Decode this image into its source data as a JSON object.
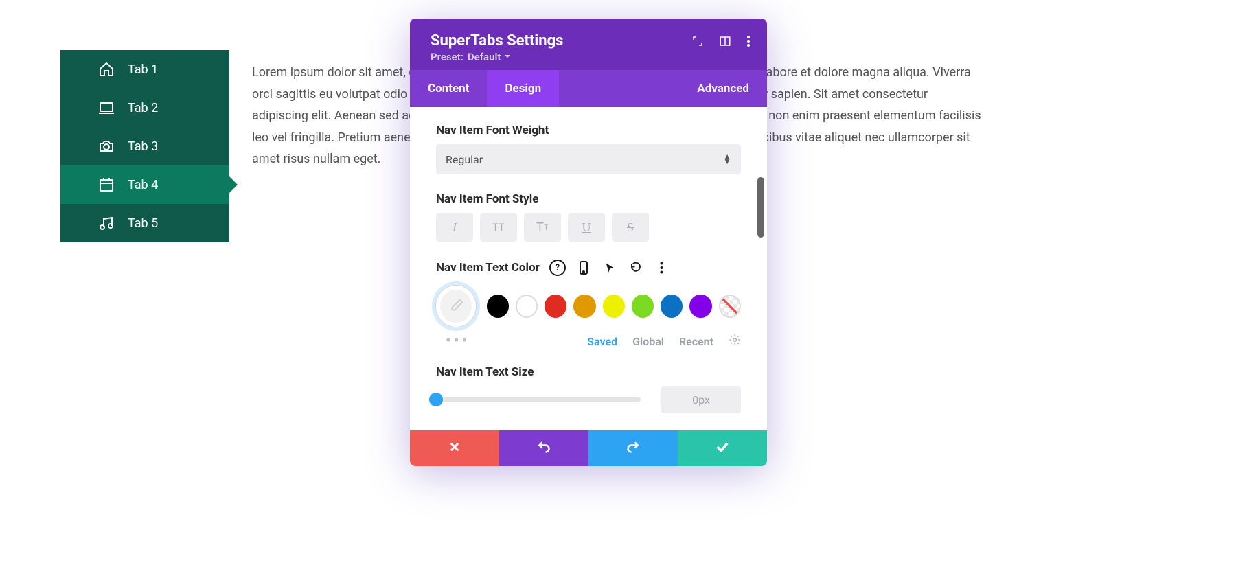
{
  "sidebar": {
    "tabs": [
      {
        "label": "Tab 1",
        "icon": "home-icon"
      },
      {
        "label": "Tab 2",
        "icon": "laptop-icon"
      },
      {
        "label": "Tab 3",
        "icon": "camera-icon"
      },
      {
        "label": "Tab 4",
        "icon": "calendar-icon",
        "active": true
      },
      {
        "label": "Tab 5",
        "icon": "music-icon"
      }
    ]
  },
  "body_text": "Lorem ipsum dolor sit amet, consectetur adipiscing elit, sed do eiusmod tempor incididunt ut labore et dolore magna aliqua. Viverra orci sagittis eu volutpat odio facilisis mauris sit amet. Imperdiet massa tincidunt nunc pulvinar sapien. Sit amet consectetur adipiscing elit. Aenean sed adipiscing diam donec adipiscing tristique risus nec feugiat. Purus non enim praesent elementum facilisis leo vel fringilla. Pretium aenean pharetra magna ac. Cursus vitae id velit ut tortor pretium. Faucibus vitae aliquet nec ullamcorper sit amet risus nullam eget.",
  "modal": {
    "title": "SuperTabs Settings",
    "preset_label": "Preset:",
    "preset_value": "Default",
    "tabs": [
      {
        "label": "Content"
      },
      {
        "label": "Design",
        "active": true
      },
      {
        "label": "Advanced"
      }
    ],
    "fields": {
      "font_weight": {
        "label": "Nav Item Font Weight",
        "value": "Regular"
      },
      "font_style": {
        "label": "Nav Item Font Style"
      },
      "text_color": {
        "label": "Nav Item Text Color"
      },
      "text_size": {
        "label": "Nav Item Text Size",
        "value": "0px"
      }
    },
    "style_buttons": [
      "italic",
      "uppercase",
      "titlecase",
      "underline",
      "strikethrough"
    ],
    "swatches": [
      "#000000",
      "#ffffff",
      "#e02b20",
      "#e09900",
      "#edf000",
      "#7cda24",
      "#0c71c3",
      "#8300e9"
    ],
    "palette_tabs": {
      "saved": "Saved",
      "global": "Global",
      "recent": "Recent",
      "active": "saved"
    }
  }
}
